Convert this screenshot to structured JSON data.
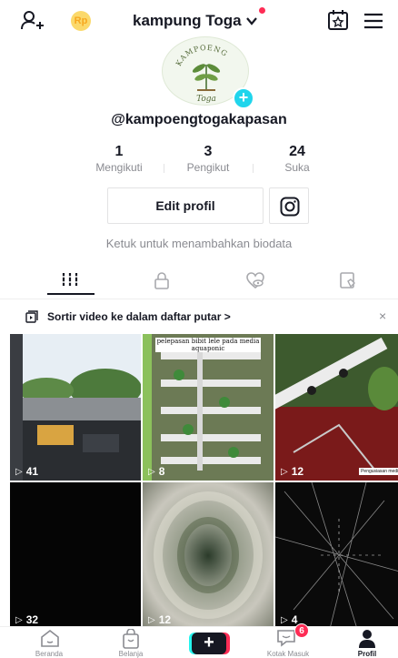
{
  "header": {
    "title": "kampung Toga",
    "coin_label": "Rp",
    "icons": [
      "add-user-icon",
      "coin-icon",
      "chevron-down-icon",
      "calendar-star-icon",
      "menu-icon"
    ],
    "notification_color": "#fe2c55"
  },
  "profile": {
    "avatar_text_top": "KAMPOENG",
    "avatar_text_bottom": "Toga",
    "handle": "@kampoengtogakapasan",
    "stats": [
      {
        "value": "1",
        "label": "Mengikuti"
      },
      {
        "value": "3",
        "label": "Pengikut"
      },
      {
        "value": "24",
        "label": "Suka"
      }
    ],
    "edit_label": "Edit profil",
    "bio_prompt": "Ketuk untuk menambahkan biodata",
    "accent_color": "#20d5ec"
  },
  "tabs": [
    {
      "name": "videos",
      "icon": "grid-icon",
      "active": true
    },
    {
      "name": "private",
      "icon": "lock-icon",
      "active": false
    },
    {
      "name": "liked",
      "icon": "heart-hidden-icon",
      "active": false
    },
    {
      "name": "favorites",
      "icon": "bookmark-icon",
      "active": false
    }
  ],
  "playlist": {
    "label": "Sortir video ke dalam daftar putar >",
    "close": "×"
  },
  "videos": [
    {
      "views": "41"
    },
    {
      "views": "8",
      "caption": "pelepasan bibit lele pada media aquaponic"
    },
    {
      "views": "12",
      "caption": "Pengusiasan media"
    },
    {
      "views": "32"
    },
    {
      "views": "12"
    },
    {
      "views": "4"
    }
  ],
  "bottom_nav": {
    "items": [
      {
        "label": "Beranda",
        "icon": "home-icon"
      },
      {
        "label": "Belanja",
        "icon": "shopping-bag-icon"
      },
      {
        "label": "",
        "icon": "plus-icon"
      },
      {
        "label": "Kotak Masuk",
        "icon": "inbox-icon"
      },
      {
        "label": "Profil",
        "icon": "profile-icon"
      }
    ],
    "inbox_badge": "6"
  }
}
